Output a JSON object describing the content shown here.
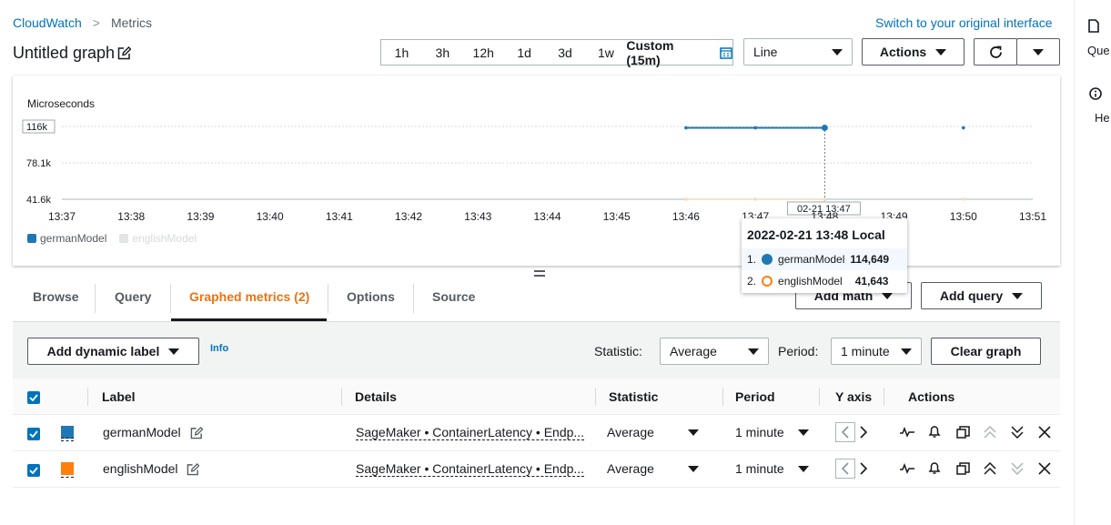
{
  "breadcrumb": {
    "root": "CloudWatch",
    "separator": ">",
    "current": "Metrics"
  },
  "header": {
    "title": "Untitled graph",
    "switch_link": "Switch to your original interface"
  },
  "right_rail": {
    "item1": "Que",
    "item2": "He"
  },
  "time_ranges": [
    "1h",
    "3h",
    "12h",
    "1d",
    "3d",
    "1w",
    "Custom (15m)"
  ],
  "chart_type_select": "Line",
  "actions_label": "Actions",
  "chart_data": {
    "type": "line",
    "ylabel": "Microseconds",
    "y_ticks": [
      "116k",
      "78.1k",
      "41.6k"
    ],
    "ylim": [
      41600,
      116000
    ],
    "x_ticks": [
      "13:37",
      "13:38",
      "13:39",
      "13:40",
      "13:41",
      "13:42",
      "13:43",
      "13:44",
      "13:45",
      "13:46",
      "13:47",
      "13:48",
      "13:49",
      "13:50",
      "13:51"
    ],
    "series": [
      {
        "name": "germanModel",
        "color": "#1f77b4",
        "x": [
          "13:46",
          "13:47",
          "13:48",
          "13:50"
        ],
        "y": [
          114649,
          114649,
          114649,
          114649
        ]
      },
      {
        "name": "englishModel",
        "color": "#ff7f0e",
        "x": [
          "13:46",
          "13:47",
          "13:48",
          "13:50"
        ],
        "y": [
          41643,
          41643,
          41643,
          41643
        ]
      }
    ],
    "crosshair_label": "02-21 13:47",
    "legend": "bottom-left"
  },
  "tooltip": {
    "title": "2022-02-21 13:48 Local",
    "rows": [
      {
        "index": "1.",
        "name": "germanModel",
        "value": "114,649"
      },
      {
        "index": "2.",
        "name": "englishModel",
        "value": "41,643"
      }
    ]
  },
  "tabs": [
    "Browse",
    "Query",
    "Graphed metrics (2)",
    "Options",
    "Source"
  ],
  "add_math": "Add math",
  "add_query": "Add query",
  "toolbar": {
    "dynamic_label": "Add dynamic label",
    "info": "Info",
    "statistic_label": "Statistic:",
    "statistic_value": "Average",
    "period_label": "Period:",
    "period_value": "1 minute",
    "clear": "Clear graph"
  },
  "table": {
    "columns": [
      "Label",
      "Details",
      "Statistic",
      "Period",
      "Y axis",
      "Actions"
    ],
    "rows": [
      {
        "color": "#1f77b4",
        "label": "germanModel",
        "details": "SageMaker • ContainerLatency • Endp...",
        "statistic": "Average",
        "period": "1 minute"
      },
      {
        "color": "#ff7f0e",
        "label": "englishModel",
        "details": "SageMaker • ContainerLatency • Endp...",
        "statistic": "Average",
        "period": "1 minute"
      }
    ]
  },
  "colors": {
    "accent": "#0073bb",
    "active_tab": "#ec7211"
  }
}
